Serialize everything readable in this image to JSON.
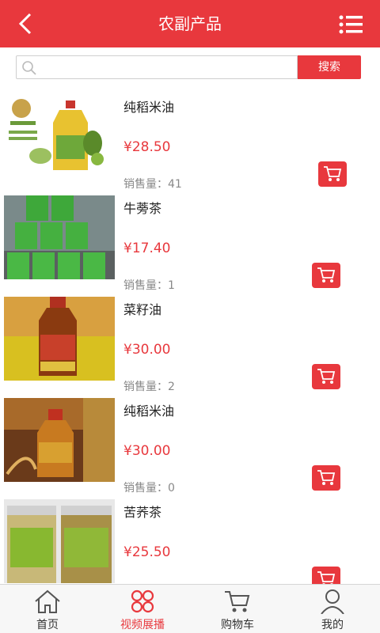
{
  "header": {
    "title": "农副产品",
    "back_icon": "chevron-left-icon",
    "menu_icon": "list-menu-icon"
  },
  "search": {
    "placeholder": "",
    "button_label": "搜索"
  },
  "products": [
    {
      "name": "纯稻米油",
      "price": "¥28.50",
      "sales_label": "销售量：41"
    },
    {
      "name": "牛蒡茶",
      "price": "¥17.40",
      "sales_label": "销售量：1"
    },
    {
      "name": "菜籽油",
      "price": "¥30.00",
      "sales_label": "销售量：2"
    },
    {
      "name": "纯稻米油",
      "price": "¥30.00",
      "sales_label": "销售量：0"
    },
    {
      "name": "苦荞茶",
      "price": "¥25.50",
      "sales_label": ""
    }
  ],
  "bottom_nav": [
    {
      "label": "首页",
      "icon": "home-icon",
      "active": false
    },
    {
      "label": "视频展播",
      "icon": "grid-icon",
      "active": true
    },
    {
      "label": "购物车",
      "icon": "cart-icon",
      "active": false
    },
    {
      "label": "我的",
      "icon": "user-icon",
      "active": false
    }
  ],
  "colors": {
    "accent": "#e8383d",
    "text": "#222222",
    "muted": "#888888"
  }
}
